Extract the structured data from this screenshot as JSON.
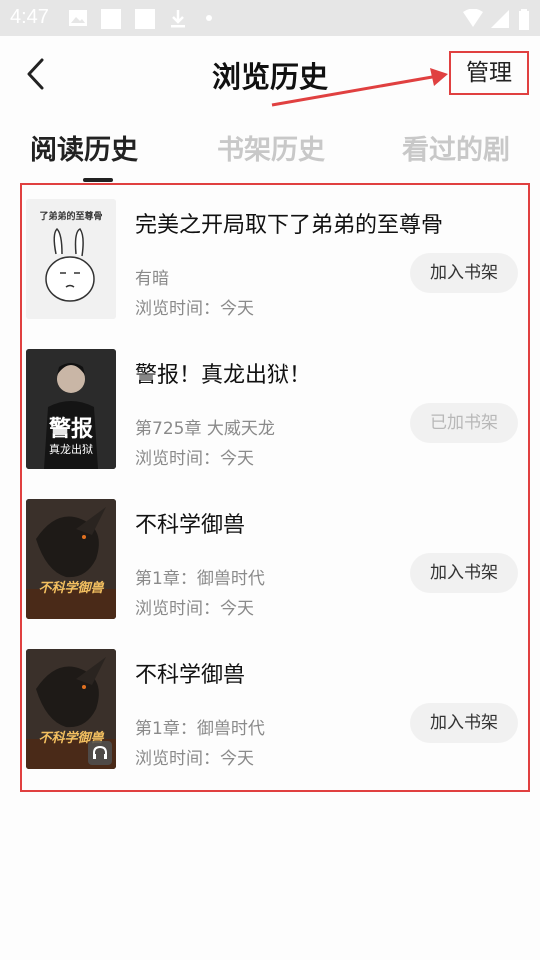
{
  "status": {
    "time": "4:47"
  },
  "header": {
    "title": "浏览历史",
    "manage_label": "管理"
  },
  "tabs": [
    {
      "label": "阅读历史",
      "active": true
    },
    {
      "label": "书架历史",
      "active": false
    },
    {
      "label": "看过的剧",
      "active": false
    }
  ],
  "items": [
    {
      "title": "完美之开局取下了弟弟的至尊骨",
      "subtitle": "有暗",
      "time": "浏览时间：今天",
      "button": "加入书架",
      "added": false
    },
    {
      "title": "警报！真龙出狱！",
      "subtitle": "第725章 大威天龙",
      "time": "浏览时间：今天",
      "button": "已加书架",
      "added": true
    },
    {
      "title": "不科学御兽",
      "subtitle": "第1章：御兽时代",
      "time": "浏览时间：今天",
      "button": "加入书架",
      "added": false
    },
    {
      "title": "不科学御兽",
      "subtitle": "第1章：御兽时代",
      "time": "浏览时间：今天",
      "button": "加入书架",
      "added": false
    }
  ],
  "covers": {
    "cover1_text": "了弟弟的至尊骨",
    "cover2_title": "警报",
    "cover2_sub": "真龙出狱",
    "cover3_text": "不科学御兽"
  },
  "colors": {
    "highlight": "#e04040",
    "active_tab": "#222222",
    "inactive_tab": "#c8c8c8"
  }
}
